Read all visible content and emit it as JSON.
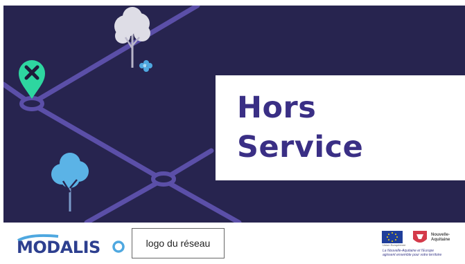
{
  "hero": {
    "title_line1": "Hors",
    "title_line2": "Service",
    "background_color": "#27244f",
    "title_color": "#3a2f85",
    "pin_color": "#2ed6a0"
  },
  "footer": {
    "brand_name": "MODALIS",
    "network_logo_placeholder": "logo du réseau",
    "eu_label": "Union Européenne",
    "region_name_line1": "Nouvelle-",
    "region_name_line2": "Aquitaine",
    "funder_line1": "La Nouvelle-Aquitaine et l'Europe",
    "funder_line2": "agissent ensemble pour votre territoire"
  }
}
